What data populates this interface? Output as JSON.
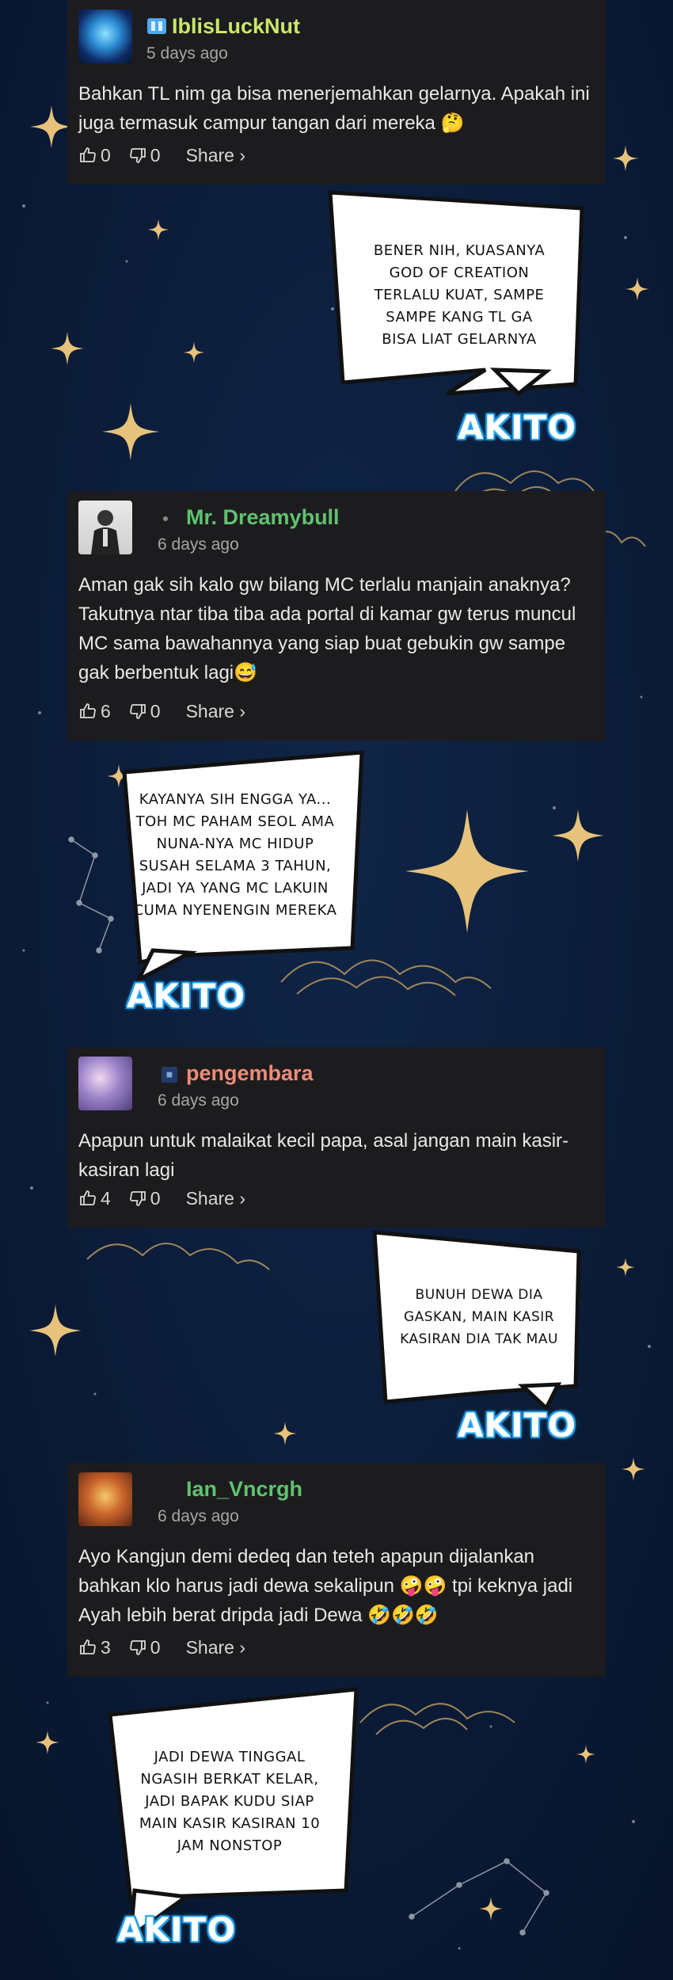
{
  "colors": {
    "background": "#0a1a33",
    "card": "#1c1c1e",
    "name_green": "#5fc36e",
    "name_salmon": "#ef8b77",
    "name_lightgreen": "#c9e76a",
    "akito_glow": "#39b8ff"
  },
  "comments": [
    {
      "username": "IblisLuckNut",
      "date": "5 days ago",
      "text": "Bahkan TL nim ga bisa menerjemahkan gelarnya. Apakah ini juga termasuk campur tangan dari mereka 🤔",
      "likes": "0",
      "dislikes": "0",
      "share": "Share ›"
    },
    {
      "username": "Mr. Dreamybull",
      "date": "6 days ago",
      "text": "Aman gak sih kalo gw bilang MC terlalu manjain anaknya? Takutnya ntar tiba tiba ada portal di kamar gw terus muncul MC sama bawahannya yang siap buat gebukin gw sampe gak berbentuk lagi😅",
      "likes": "6",
      "dislikes": "0",
      "share": "Share ›"
    },
    {
      "username": "pengembara",
      "date": "6 days ago",
      "text": "Apapun untuk malaikat kecil papa, asal jangan main kasir-kasiran lagi",
      "likes": "4",
      "dislikes": "0",
      "share": "Share ›"
    },
    {
      "username": "Ian_Vncrgh",
      "date": "6 days ago",
      "text": "Ayo Kangjun demi dedeq dan teteh apapun dijalankan bahkan klo harus jadi dewa sekalipun 🤪🤪 tpi keknya jadi Ayah lebih berat dripda jadi Dewa 🤣🤣🤣",
      "likes": "3",
      "dislikes": "0",
      "share": "Share ›"
    }
  ],
  "bubbles": [
    {
      "lines": [
        "BENER NIH, KUASANYA",
        "GOD OF CREATION",
        "TERLALU KUAT, SAMPE",
        "SAMPE KANG TL GA",
        "BISA LIAT GELARNYA"
      ],
      "signature": "AKITO"
    },
    {
      "lines": [
        "KAYANYA SIH ENGGA YA...",
        "TOH MC PAHAM SEOL AMA",
        "NUNA-NYA MC HIDUP",
        "SUSAH SELAMA 3 TAHUN,",
        "JADI YA YANG MC LAKUIN",
        "CUMA NYENENGIN MEREKA"
      ],
      "signature": "AKITO"
    },
    {
      "lines": [
        "BUNUH DEWA DIA",
        "GASKAN, MAIN KASIR",
        "KASIRAN DIA TAK MAU"
      ],
      "signature": "AKITO"
    },
    {
      "lines": [
        "JADI DEWA TINGGAL",
        "NGASIH BERKAT KELAR,",
        "JADI BAPAK KUDU SIAP",
        "MAIN KASIR KASIRAN 10",
        "JAM NONSTOP"
      ],
      "signature": "AKITO"
    }
  ]
}
